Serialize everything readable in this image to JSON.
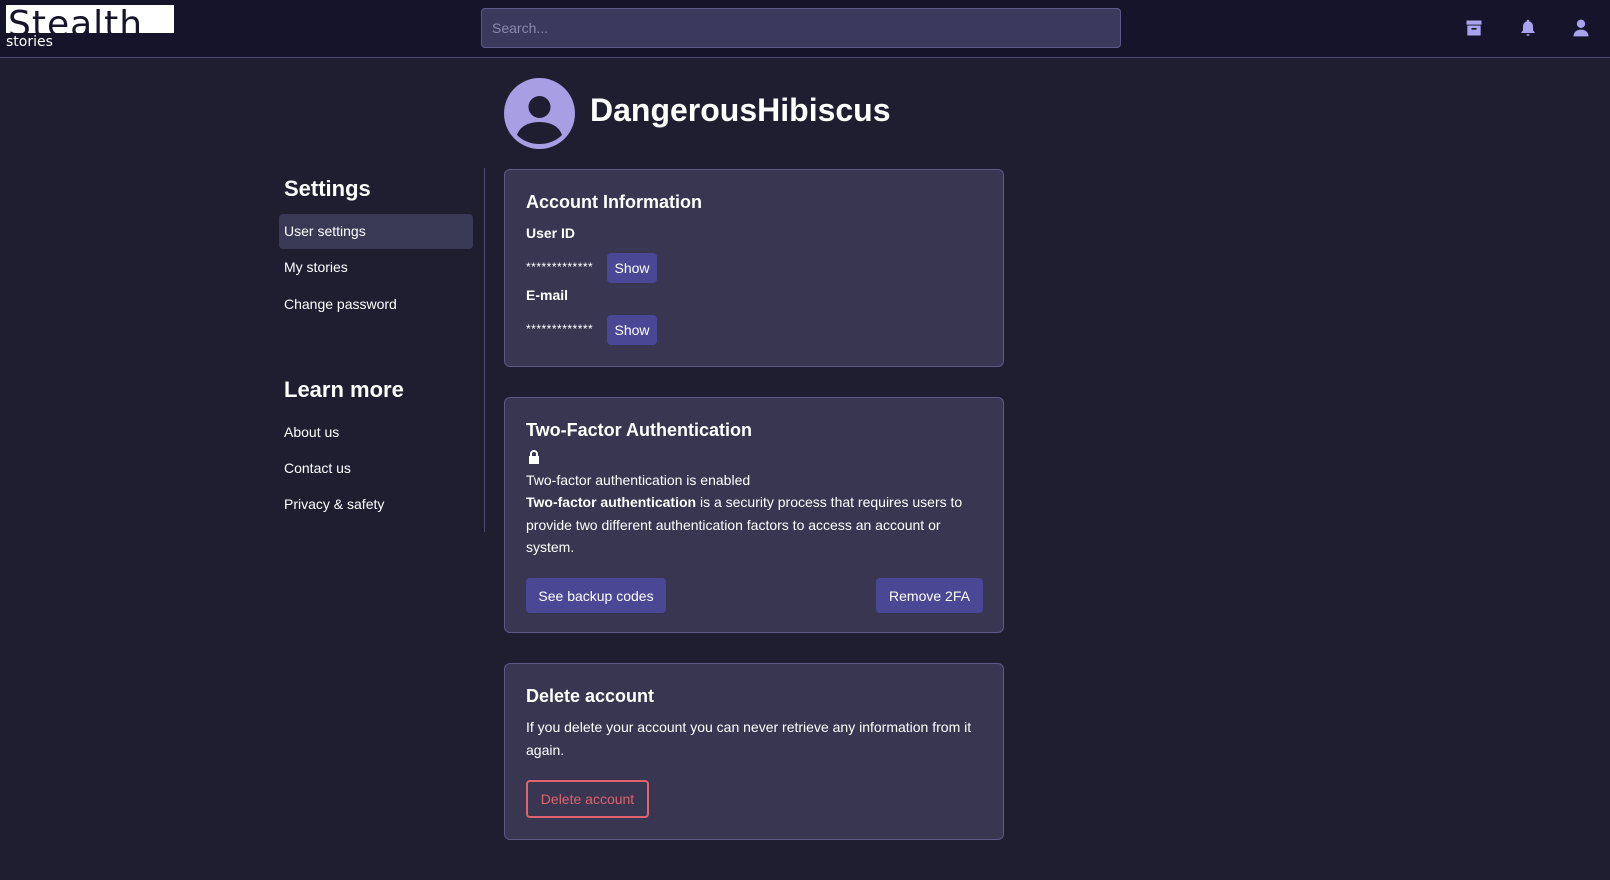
{
  "header": {
    "logo_main": "Stealth",
    "logo_sub": "stories",
    "search_placeholder": "Search...",
    "icons": [
      "archive-icon",
      "bell-icon",
      "user-icon"
    ]
  },
  "sidebar": {
    "settings_heading": "Settings",
    "settings_items": [
      {
        "label": "User settings",
        "active": true
      },
      {
        "label": "My stories",
        "active": false
      },
      {
        "label": "Change password",
        "active": false
      }
    ],
    "learn_heading": "Learn more",
    "learn_items": [
      {
        "label": "About us"
      },
      {
        "label": "Contact us"
      },
      {
        "label": "Privacy & safety"
      }
    ]
  },
  "profile": {
    "username": "DangerousHibiscus"
  },
  "account_info": {
    "title": "Account Information",
    "user_id_label": "User ID",
    "user_id_masked": "*************",
    "email_label": "E-mail",
    "email_masked": "*************",
    "show_label": "Show"
  },
  "two_factor": {
    "title": "Two-Factor Authentication",
    "status": "Two-factor authentication is enabled",
    "desc_bold": "Two-factor authentication",
    "desc_rest": " is a security process that requires users to provide two different authentication factors to access an account or system.",
    "backup_button": "See backup codes",
    "remove_button": "Remove 2FA"
  },
  "delete_account": {
    "title": "Delete account",
    "text": "If you delete your account you can never retrieve any information from it again.",
    "button": "Delete account"
  },
  "colors": {
    "background": "#1f1e31",
    "card": "#383650",
    "accent": "#a79ee4",
    "button": "#4a4794",
    "danger": "#e0636e"
  }
}
